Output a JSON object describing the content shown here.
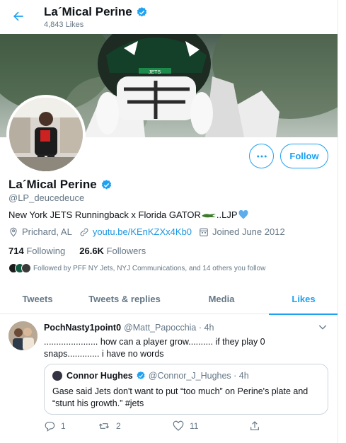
{
  "header": {
    "name": "La´Mical Perine",
    "likes_count": "4,843 Likes"
  },
  "profile": {
    "name": "La´Mical Perine",
    "handle": "@LP_deucedeuce",
    "bio": "New York JETS Runningback x Florida GATOR",
    "bio_suffix": "..LJP",
    "location": "Prichard, AL",
    "website": "youtu.be/KEnKZXx4Kb0",
    "joined": "Joined June 2012",
    "following_count": "714",
    "following_label": "Following",
    "followers_count": "26.6K",
    "followers_label": "Followers",
    "followed_by": "Followed by PFF NY Jets, NYJ Communications, and 14 others you follow",
    "follow_button": "Follow"
  },
  "tabs": [
    {
      "label": "Tweets"
    },
    {
      "label": "Tweets & replies"
    },
    {
      "label": "Media"
    },
    {
      "label": "Likes"
    }
  ],
  "tweet": {
    "display_name": "PochNasty1point0",
    "handle_time": "@Matt_Papocchia · 4h",
    "text": "...................... how can a player grow.......... if they play 0 snaps............. i have no words",
    "quote": {
      "display_name": "Connor Hughes",
      "handle_time": "@Connor_J_Hughes · 4h",
      "text": "Gase said Jets don't want to put “too much” on Perine's plate and “stunt his growth.” #jets"
    },
    "reply_count": "1",
    "retweet_count": "2",
    "like_count": "11"
  },
  "colors": {
    "accent": "#1da1f2",
    "link": "#1b95e0",
    "muted": "#657786",
    "text": "#0f1419"
  },
  "icons": [
    "back-arrow-icon",
    "verified-icon",
    "more-icon",
    "location-icon",
    "link-icon",
    "calendar-icon",
    "reply-icon",
    "retweet-icon",
    "like-icon",
    "share-icon",
    "chevron-down-icon"
  ]
}
